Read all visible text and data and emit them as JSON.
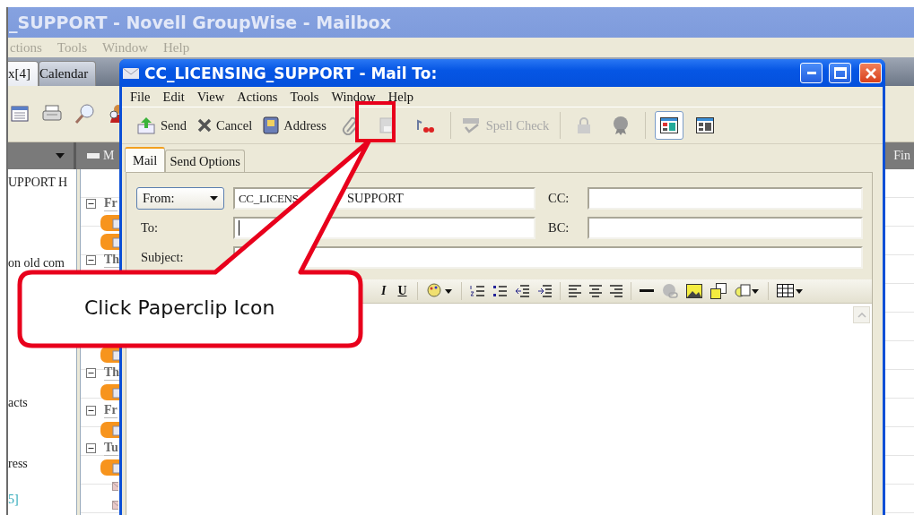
{
  "background_window": {
    "title": "_SUPPORT - Novell GroupWise - Mailbox",
    "menu": [
      "ctions",
      "Tools",
      "Window",
      "Help"
    ],
    "tabs": [
      {
        "label": "x[4]",
        "selected": true
      },
      {
        "label": "Calendar",
        "selected": false
      }
    ],
    "column_headers": [
      "M",
      "Fin"
    ],
    "folder_list": [
      {
        "text": "UPPORT H",
        "kind": "text"
      },
      {
        "text": "on old com",
        "kind": "text"
      },
      {
        "text": "acts",
        "kind": "text"
      },
      {
        "text": "ress",
        "kind": "text"
      },
      {
        "text": "5]",
        "kind": "link"
      }
    ],
    "message_groups": [
      {
        "label": "Fr",
        "expanded": true,
        "items": [
          {
            "kind": "highlighted"
          },
          {
            "kind": "highlighted"
          }
        ]
      },
      {
        "label": "Th",
        "expanded": true,
        "items": [
          {
            "kind": "highlighted"
          }
        ]
      },
      {
        "label": "Th",
        "expanded": true,
        "items": [
          {
            "kind": "highlighted"
          }
        ]
      },
      {
        "label": "Fr",
        "expanded": true,
        "items": [
          {
            "kind": "highlighted"
          }
        ]
      },
      {
        "label": "Tu",
        "expanded": true,
        "items": [
          {
            "kind": "highlighted"
          },
          {
            "kind": "plain"
          },
          {
            "kind": "plain"
          }
        ]
      }
    ]
  },
  "compose_window": {
    "title": "CC_LICENSING_SUPPORT - Mail To:",
    "menu": [
      "File",
      "Edit",
      "View",
      "Actions",
      "Tools",
      "Window",
      "Help"
    ],
    "toolbar": [
      {
        "label": "Send",
        "disabled": false
      },
      {
        "label": "Cancel",
        "disabled": false
      },
      {
        "label": "Address",
        "disabled": false
      },
      {
        "label": "Spell Check",
        "disabled": true
      }
    ],
    "view_buttons": [
      {
        "selected": true
      },
      {
        "selected": false
      }
    ],
    "tabs": [
      {
        "label": "Mail",
        "selected": true
      },
      {
        "label": "Send Options",
        "selected": false
      }
    ],
    "from_button": "From:",
    "from_value_visible": [
      "CC_LICENS",
      "SUPPORT"
    ],
    "cc_label": "CC:",
    "to_label": "To:",
    "bc_label": "BC:",
    "subject_label": "Subject:",
    "format_toolbar": [
      "I",
      "U"
    ]
  },
  "callout": {
    "text": "Click Paperclip Icon"
  }
}
